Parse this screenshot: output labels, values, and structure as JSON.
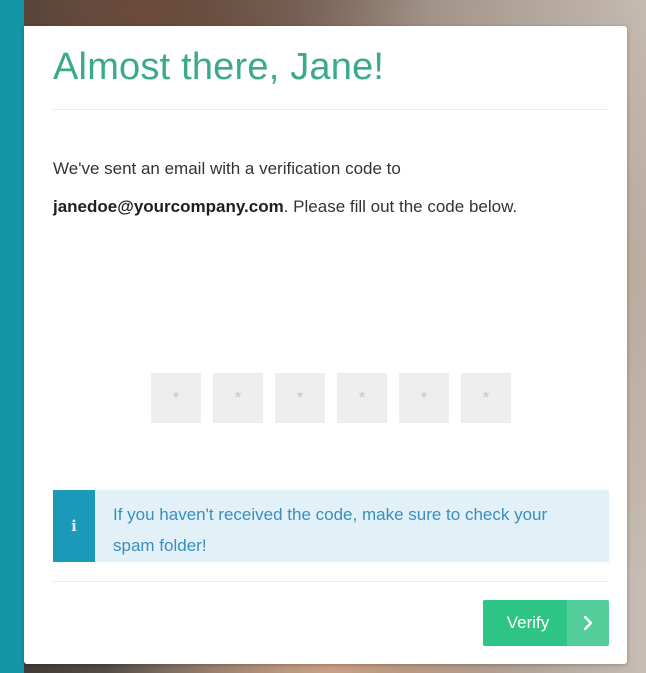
{
  "colors": {
    "title": "#3aaa8a",
    "info_accent": "#1c98b9",
    "info_background": "#e1f1f7",
    "info_text": "#3a8ec0",
    "button": "#2ec486",
    "page_background": "#1496a6"
  },
  "dialog": {
    "title": "Almost there, Jane!",
    "message_line1": "We've sent an email with a verification code to",
    "email": "janedoe@yourcompany.com",
    "message_tail": ". Please fill out the code below."
  },
  "code_inputs": {
    "count": 6,
    "placeholder": "*"
  },
  "info": {
    "icon": "info-icon",
    "glyph": "i",
    "text": "If you haven't received the code, make sure to check your spam folder!"
  },
  "actions": {
    "verify_label": "Verify",
    "verify_icon": "chevron-right-icon"
  }
}
